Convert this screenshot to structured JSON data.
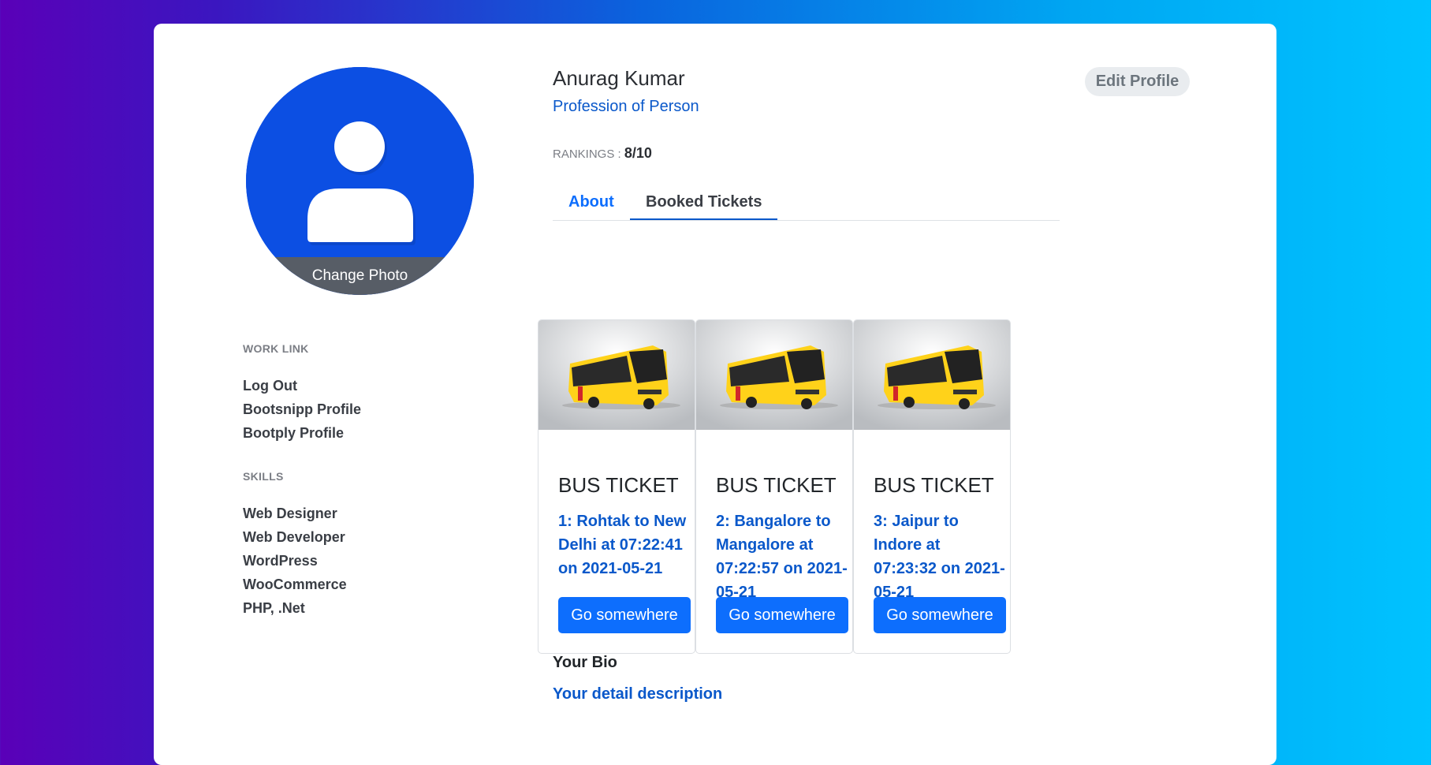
{
  "profile": {
    "name": "Anurag Kumar",
    "profession": "Profession of Person",
    "rankings_label": "RANKINGS :",
    "rankings_value": "8/10",
    "edit_button": "Edit Profile",
    "change_photo": "Change Photo",
    "avatar_icon": "person-icon"
  },
  "tabs": [
    {
      "label": "About",
      "active": false
    },
    {
      "label": "Booked Tickets",
      "active": true
    }
  ],
  "sidebar": {
    "work_link_heading": "WORK LINK",
    "work_links": [
      "Log Out",
      "Bootsnipp Profile",
      "Bootply Profile"
    ],
    "skills_heading": "SKILLS",
    "skills": [
      "Web Designer",
      "Web Developer",
      "WordPress",
      "WooCommerce",
      "PHP, .Net"
    ]
  },
  "tickets": [
    {
      "title": "BUS TICKET",
      "desc": "1: Rohtak to New Delhi at 07:22:41 on 2021-05-21",
      "button": "Go somewhere",
      "image_icon": "bus-image"
    },
    {
      "title": "BUS TICKET",
      "desc": "2: Bangalore to Mangalore at 07:22:57 on 2021-05-21",
      "button": "Go somewhere",
      "image_icon": "bus-image"
    },
    {
      "title": "BUS TICKET",
      "desc": "3: Jaipur to Indore at 07:23:32 on 2021-05-21",
      "button": "Go somewhere",
      "image_icon": "bus-image"
    }
  ],
  "bio": {
    "title": "Your Bio",
    "description": "Your detail description"
  },
  "colors": {
    "primary": "#0d6efd",
    "link": "#0a58ca",
    "avatar_bg": "#0c4fe3",
    "bus_yellow": "#ffd21a"
  }
}
